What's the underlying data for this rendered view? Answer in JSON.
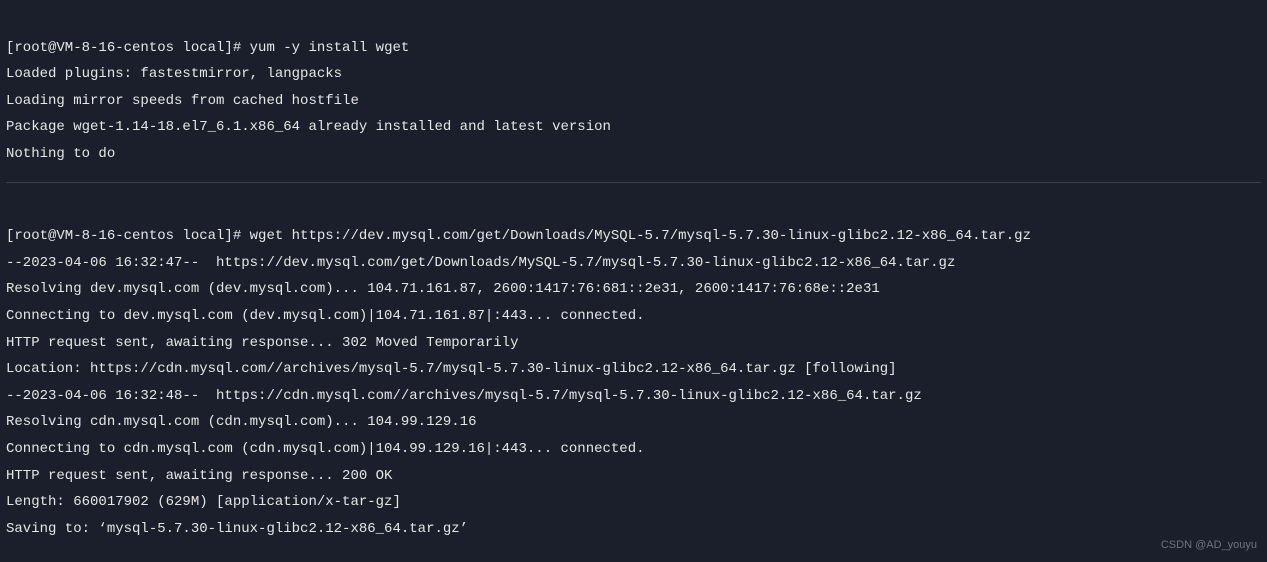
{
  "block1": {
    "prompt1": "[root@VM-8-16-centos local]# ",
    "cmd1": "yum -y install wget",
    "l1": "Loaded plugins: fastestmirror, langpacks",
    "l2": "Loading mirror speeds from cached hostfile",
    "l3": "Package wget-1.14-18.el7_6.1.x86_64 already installed and latest version",
    "l4": "Nothing to do"
  },
  "block2": {
    "prompt2": "[root@VM-8-16-centos local]# ",
    "cmd2": "wget https://dev.mysql.com/get/Downloads/MySQL-5.7/mysql-5.7.30-linux-glibc2.12-x86_64.tar.gz",
    "l1": "--2023-04-06 16:32:47--  https://dev.mysql.com/get/Downloads/MySQL-5.7/mysql-5.7.30-linux-glibc2.12-x86_64.tar.gz",
    "l2": "Resolving dev.mysql.com (dev.mysql.com)... 104.71.161.87, 2600:1417:76:681::2e31, 2600:1417:76:68e::2e31",
    "l3": "Connecting to dev.mysql.com (dev.mysql.com)|104.71.161.87|:443... connected.",
    "l4": "HTTP request sent, awaiting response... 302 Moved Temporarily",
    "l5": "Location: https://cdn.mysql.com//archives/mysql-5.7/mysql-5.7.30-linux-glibc2.12-x86_64.tar.gz [following]",
    "l6": "--2023-04-06 16:32:48--  https://cdn.mysql.com//archives/mysql-5.7/mysql-5.7.30-linux-glibc2.12-x86_64.tar.gz",
    "l7": "Resolving cdn.mysql.com (cdn.mysql.com)... 104.99.129.16",
    "l8": "Connecting to cdn.mysql.com (cdn.mysql.com)|104.99.129.16|:443... connected.",
    "l9": "HTTP request sent, awaiting response... 200 OK",
    "l10": "Length: 660017902 (629M) [application/x-tar-gz]",
    "l11": "Saving to: ‘mysql-5.7.30-linux-glibc2.12-x86_64.tar.gz’"
  },
  "watermark": "CSDN @AD_youyu"
}
